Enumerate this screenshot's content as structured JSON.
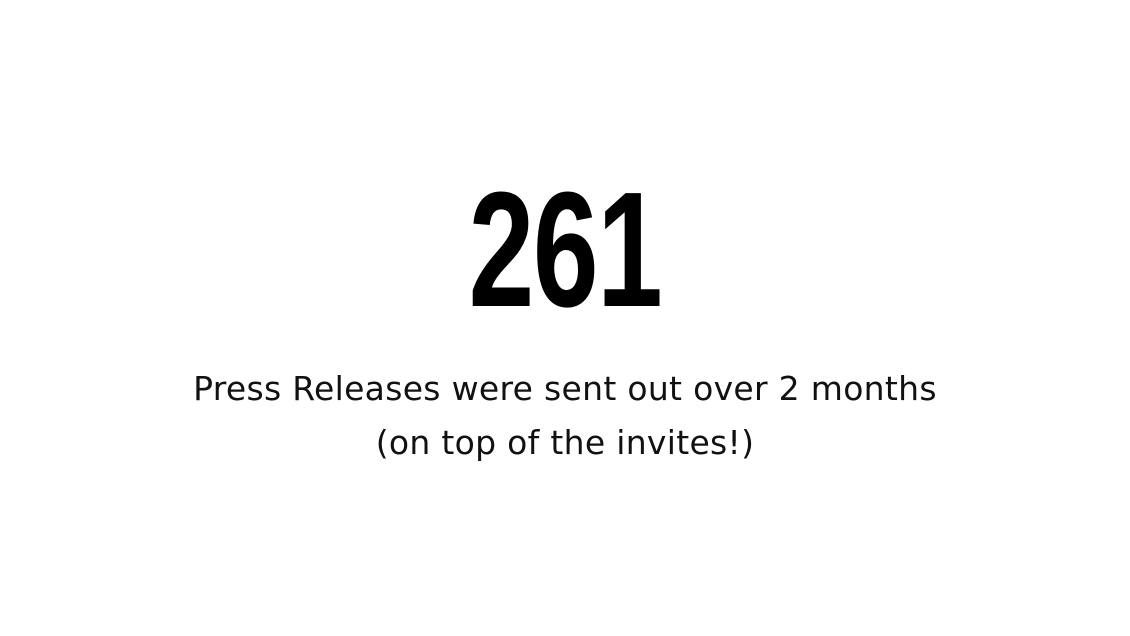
{
  "slide": {
    "number": "261",
    "caption_line1": "Press Releases were sent out over 2 months",
    "caption_line2": "(on top of the invites!)"
  }
}
